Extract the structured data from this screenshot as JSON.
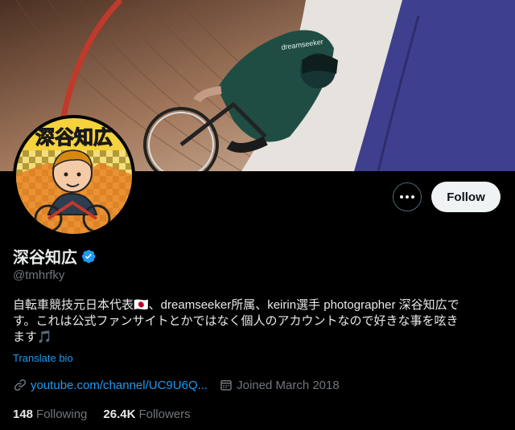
{
  "profile": {
    "display_name": "深谷知広",
    "handle": "@tmhrfky",
    "bio_line1": "自転車競技元日本代表🇯🇵、dreamseeker所属、keirin選手 photographer 深谷知広で",
    "bio_line2": "す。これは公式ファンサイトとかではなく個人のアカウントなので好きな事を呟き",
    "bio_line3": "ます🎵",
    "translate_label": "Translate bio",
    "website": "youtube.com/channel/UC9U6Q...",
    "joined": "Joined March 2018",
    "following_count": "148",
    "following_label": "Following",
    "followers_count": "26.4K",
    "followers_label": "Followers",
    "avatar_text": "深谷知広"
  },
  "actions": {
    "follow_label": "Follow",
    "more_icon": "more-icon"
  },
  "colors": {
    "accent": "#1d9bf0",
    "background": "#000000",
    "muted_text": "#71767b"
  }
}
